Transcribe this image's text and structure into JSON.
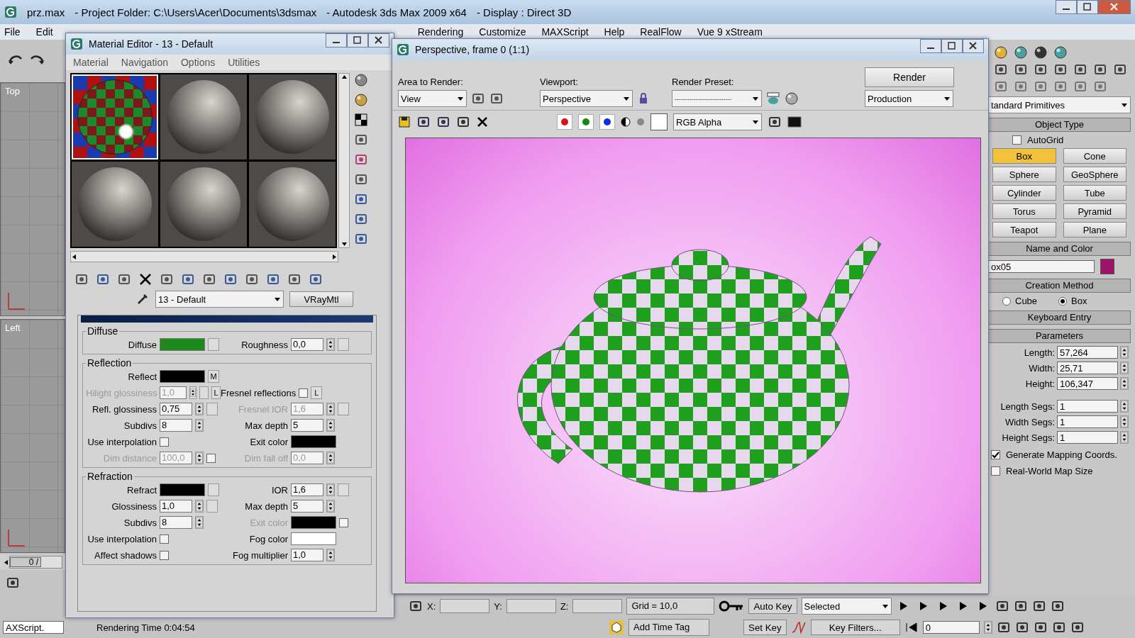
{
  "main_window": {
    "title_parts": [
      "prz.max",
      "- Project Folder: C:\\Users\\Acer\\Documents\\3dsmax",
      "- Autodesk 3ds Max  2009 x64",
      "- Display : Direct 3D"
    ],
    "menu_left": [
      "File",
      "Edit"
    ],
    "menu_right": [
      "Rendering",
      "Customize",
      "MAXScript",
      "Help",
      "RealFlow",
      "Vue 9 xStream"
    ]
  },
  "viewports": [
    {
      "label": "Top"
    },
    {
      "label": "Left"
    }
  ],
  "timeline": {
    "frame_label": "0 /",
    "level": 0
  },
  "maxscript": {
    "value": "AXScript."
  },
  "status": {
    "rendering_time": "Rendering Time  0:04:54"
  },
  "material_editor": {
    "title": "Material Editor - 13 - Default",
    "menu": [
      "Material",
      "Navigation",
      "Options",
      "Utilities"
    ],
    "slots": [
      {
        "selected": true
      },
      {
        "selected": false
      },
      {
        "selected": false
      },
      {
        "selected": false
      },
      {
        "selected": false
      },
      {
        "selected": false
      }
    ],
    "material_name": "13 - Default",
    "material_type": "VRayMtl",
    "groups": [
      {
        "title": "Diffuse",
        "rows": [
          {
            "left": {
              "kind": "color",
              "label": "Diffuse",
              "color": "#1f8a1c",
              "disabled": false,
              "extras": [
                {
                  "kind": "map"
                }
              ]
            },
            "right": {
              "kind": "spinner",
              "label": "Roughness",
              "value": "0,0",
              "disabled": false,
              "extras": [
                {
                  "kind": "map"
                }
              ]
            }
          }
        ]
      },
      {
        "title": "Reflection",
        "rows": [
          {
            "left": {
              "kind": "color",
              "label": "Reflect",
              "color": "#000000",
              "disabled": false,
              "extras": [
                {
                  "kind": "map",
                  "label": "M"
                }
              ]
            }
          },
          {
            "left": {
              "kind": "spinner",
              "label": "Hilight glossiness",
              "value": "1,0",
              "disabled": true,
              "extras": [
                {
                  "kind": "map"
                },
                {
                  "kind": "map",
                  "label": "L"
                }
              ]
            },
            "right": {
              "kind": "check",
              "label": "Fresnel reflections",
              "checked": false,
              "disabled": false,
              "extras": [
                {
                  "kind": "map",
                  "label": "L"
                }
              ]
            }
          },
          {
            "left": {
              "kind": "spinner",
              "label": "Refl. glossiness",
              "value": "0,75",
              "disabled": false,
              "extras": [
                {
                  "kind": "map"
                }
              ]
            },
            "right": {
              "kind": "spinner",
              "label": "Fresnel IOR",
              "value": "1,6",
              "disabled": true,
              "extras": [
                {
                  "kind": "map"
                }
              ]
            }
          },
          {
            "left": {
              "kind": "spinner",
              "label": "Subdivs",
              "value": "8",
              "disabled": false
            },
            "right": {
              "kind": "spinner",
              "label": "Max depth",
              "value": "5",
              "disabled": false
            }
          },
          {
            "left": {
              "kind": "check",
              "label": "Use interpolation",
              "checked": false,
              "disabled": false
            },
            "right": {
              "kind": "color",
              "label": "Exit color",
              "color": "#000000",
              "disabled": false
            }
          },
          {
            "left": {
              "kind": "spinner",
              "label": "Dim distance",
              "value": "100,0",
              "disabled": true,
              "extras": [
                {
                  "kind": "check",
                  "checked": false
                }
              ]
            },
            "right": {
              "kind": "spinner",
              "label": "Dim fall off",
              "value": "0,0",
              "disabled": true
            }
          }
        ]
      },
      {
        "title": "Refraction",
        "rows": [
          {
            "left": {
              "kind": "color",
              "label": "Refract",
              "color": "#000000",
              "disabled": false,
              "extras": [
                {
                  "kind": "map"
                }
              ]
            },
            "right": {
              "kind": "spinner",
              "label": "IOR",
              "value": "1,6",
              "disabled": false,
              "extras": [
                {
                  "kind": "map"
                }
              ]
            }
          },
          {
            "left": {
              "kind": "spinner",
              "label": "Glossiness",
              "value": "1,0",
              "disabled": false,
              "extras": [
                {
                  "kind": "map"
                }
              ]
            },
            "right": {
              "kind": "spinner",
              "label": "Max depth",
              "value": "5",
              "disabled": false
            }
          },
          {
            "left": {
              "kind": "spinner",
              "label": "Subdivs",
              "value": "8",
              "disabled": false
            },
            "right": {
              "kind": "color",
              "label": "Exit color",
              "color": "#000000",
              "disabled": true,
              "extras": [
                {
                  "kind": "check",
                  "checked": false
                }
              ]
            }
          },
          {
            "left": {
              "kind": "check",
              "label": "Use interpolation",
              "checked": false,
              "disabled": false
            },
            "right": {
              "kind": "color",
              "label": "Fog color",
              "color": "#ffffff",
              "disabled": false
            }
          },
          {
            "left": {
              "kind": "check",
              "label": "Affect shadows",
              "checked": false,
              "disabled": false
            },
            "right": {
              "kind": "spinner",
              "label": "Fog multiplier",
              "value": "1,0",
              "disabled": false
            }
          }
        ]
      }
    ]
  },
  "render_frame": {
    "title": "Perspective, frame 0 (1:1)",
    "area_label": "Area to Render:",
    "area_value": "View",
    "viewport_label": "Viewport:",
    "viewport_value": "Perspective",
    "preset_label": "Render Preset:",
    "preset_value": "------------------------------",
    "render_button": "Render",
    "production_value": "Production",
    "channels": [
      {
        "color": "#e01010",
        "selected": true
      },
      {
        "color": "#108a10",
        "selected": true
      },
      {
        "color": "#1030e0",
        "selected": true
      }
    ],
    "channel_value": "RGB Alpha"
  },
  "command_panel": {
    "category": "tandard Primitives",
    "object_type": {
      "title": "Object Type",
      "autogrid": {
        "label": "AutoGrid",
        "checked": false
      },
      "buttons": [
        {
          "label": "Box",
          "selected": true
        },
        {
          "label": "Cone",
          "selected": false
        },
        {
          "label": "Sphere",
          "selected": false
        },
        {
          "label": "GeoSphere",
          "selected": false
        },
        {
          "label": "Cylinder",
          "selected": false
        },
        {
          "label": "Tube",
          "selected": false
        },
        {
          "label": "Torus",
          "selected": false
        },
        {
          "label": "Pyramid",
          "selected": false
        },
        {
          "label": "Teapot",
          "selected": false
        },
        {
          "label": "Plane",
          "selected": false
        }
      ]
    },
    "name_color": {
      "title": "Name and Color",
      "name": "ox05",
      "color": "#9c1468"
    },
    "creation_method": {
      "title": "Creation Method",
      "options": [
        {
          "label": "Cube",
          "selected": false
        },
        {
          "label": "Box",
          "selected": true
        }
      ]
    },
    "keyboard_entry": {
      "title": "Keyboard Entry"
    },
    "parameters": {
      "title": "Parameters",
      "fields": [
        {
          "label": "Length:",
          "value": "57,264"
        },
        {
          "label": "Width:",
          "value": "25,71"
        },
        {
          "label": "Height:",
          "value": "106,347"
        }
      ],
      "segs": [
        {
          "label": "Length Segs:",
          "value": "1"
        },
        {
          "label": "Width Segs:",
          "value": "1"
        },
        {
          "label": "Height Segs:",
          "value": "1"
        }
      ],
      "checks": [
        {
          "label": "Generate Mapping Coords.",
          "checked": true
        },
        {
          "label": "Real-World Map Size",
          "checked": false
        }
      ]
    }
  },
  "bottom_bar": {
    "coords": [
      {
        "label": "X:"
      },
      {
        "label": "Y:"
      },
      {
        "label": "Z:"
      }
    ],
    "grid": "Grid = 10,0",
    "add_time_tag": "Add Time Tag",
    "auto_key": "Auto Key",
    "key_mode": "Selected",
    "set_key": "Set Key",
    "key_filters": "Key Filters...",
    "frame": "0"
  }
}
